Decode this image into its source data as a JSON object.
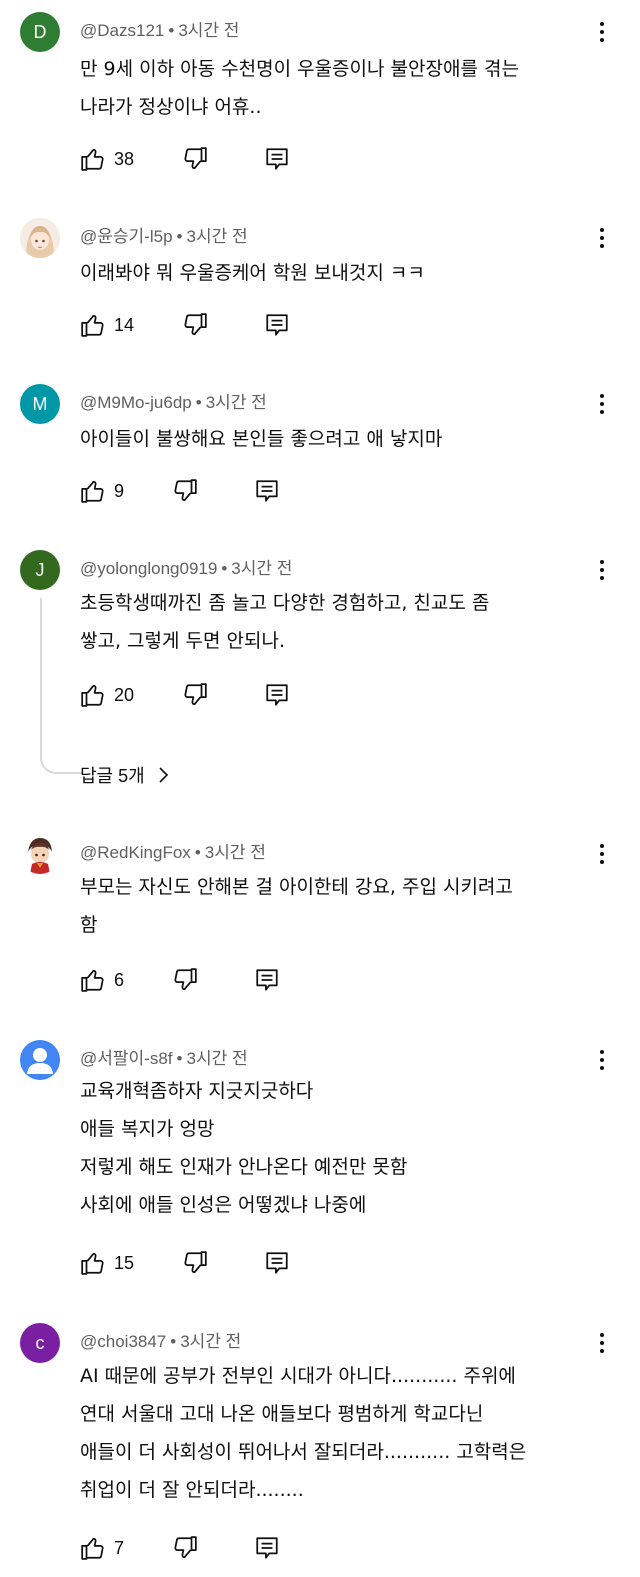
{
  "comments": [
    {
      "author": "@Dazs121",
      "time": "3시간 전",
      "avatar_letter": "D",
      "avatar_color": "#2e7d32",
      "lines": [
        "만 9세 이하 아동 수천명이 우울증이나 불안장애를 겪는",
        "나라가 정상이냐 어휴.."
      ],
      "likes": "38"
    },
    {
      "author": "@윤승기-l5p",
      "time": "3시간 전",
      "avatar_letter": "",
      "avatar_color": "#f3e6dc",
      "lines": [
        "이래봐야 뭐 우울증케어 학원 보내것지 ㅋㅋ"
      ],
      "likes": "14"
    },
    {
      "author": "@M9Mo-ju6dp",
      "time": "3시간 전",
      "avatar_letter": "M",
      "avatar_color": "#0097a7",
      "lines": [
        "아이들이 불쌍해요 본인들 좋으려고 애 낳지마"
      ],
      "likes": "9"
    },
    {
      "author": "@yolonglong0919",
      "time": "3시간 전",
      "avatar_letter": "J",
      "avatar_color": "#33691e",
      "lines": [
        "초등학생때까진 좀 놀고 다양한 경험하고, 친교도 좀",
        "쌓고, 그렇게 두면 안되나."
      ],
      "likes": "20",
      "replies_label": "답글 5개"
    },
    {
      "author": "@RedKingFox",
      "time": "3시간 전",
      "avatar_letter": "",
      "avatar_color": "#ffffff",
      "lines": [
        "부모는 자신도 안해본 걸 아이한테 강요, 주입 시키려고",
        "함"
      ],
      "likes": "6"
    },
    {
      "author": "@서팔이-s8f",
      "time": "3시간 전",
      "avatar_letter": "",
      "avatar_color": "#4285f4",
      "lines": [
        "교육개혁좀하자 지긋지긋하다",
        "애들 복지가 엉망",
        "저렇게 해도 인재가 안나온다 예전만 못함",
        "사회에 애들 인성은 어떻겠냐 나중에"
      ],
      "likes": "15"
    },
    {
      "author": "@choi3847",
      "time": "3시간 전",
      "avatar_letter": "c",
      "avatar_color": "#7b1fa2",
      "lines": [
        "AI 때문에  공부가 전부인 시대가 아니다...........  주위에",
        "연대 서울대 고대 나온 애들보다   평범하게 학교다닌",
        "애들이 더 사회성이 뛰어나서 잘되더라...........  고학력은",
        "취업이 더 잘 안되더라........"
      ],
      "likes": "7"
    }
  ],
  "separator": "•",
  "icons": {
    "like": "thumbs-up-icon",
    "dislike": "thumbs-down-icon",
    "reply": "reply-icon",
    "more": "more-vert-icon",
    "chevron": "chevron-right-icon",
    "person": "person-icon"
  }
}
